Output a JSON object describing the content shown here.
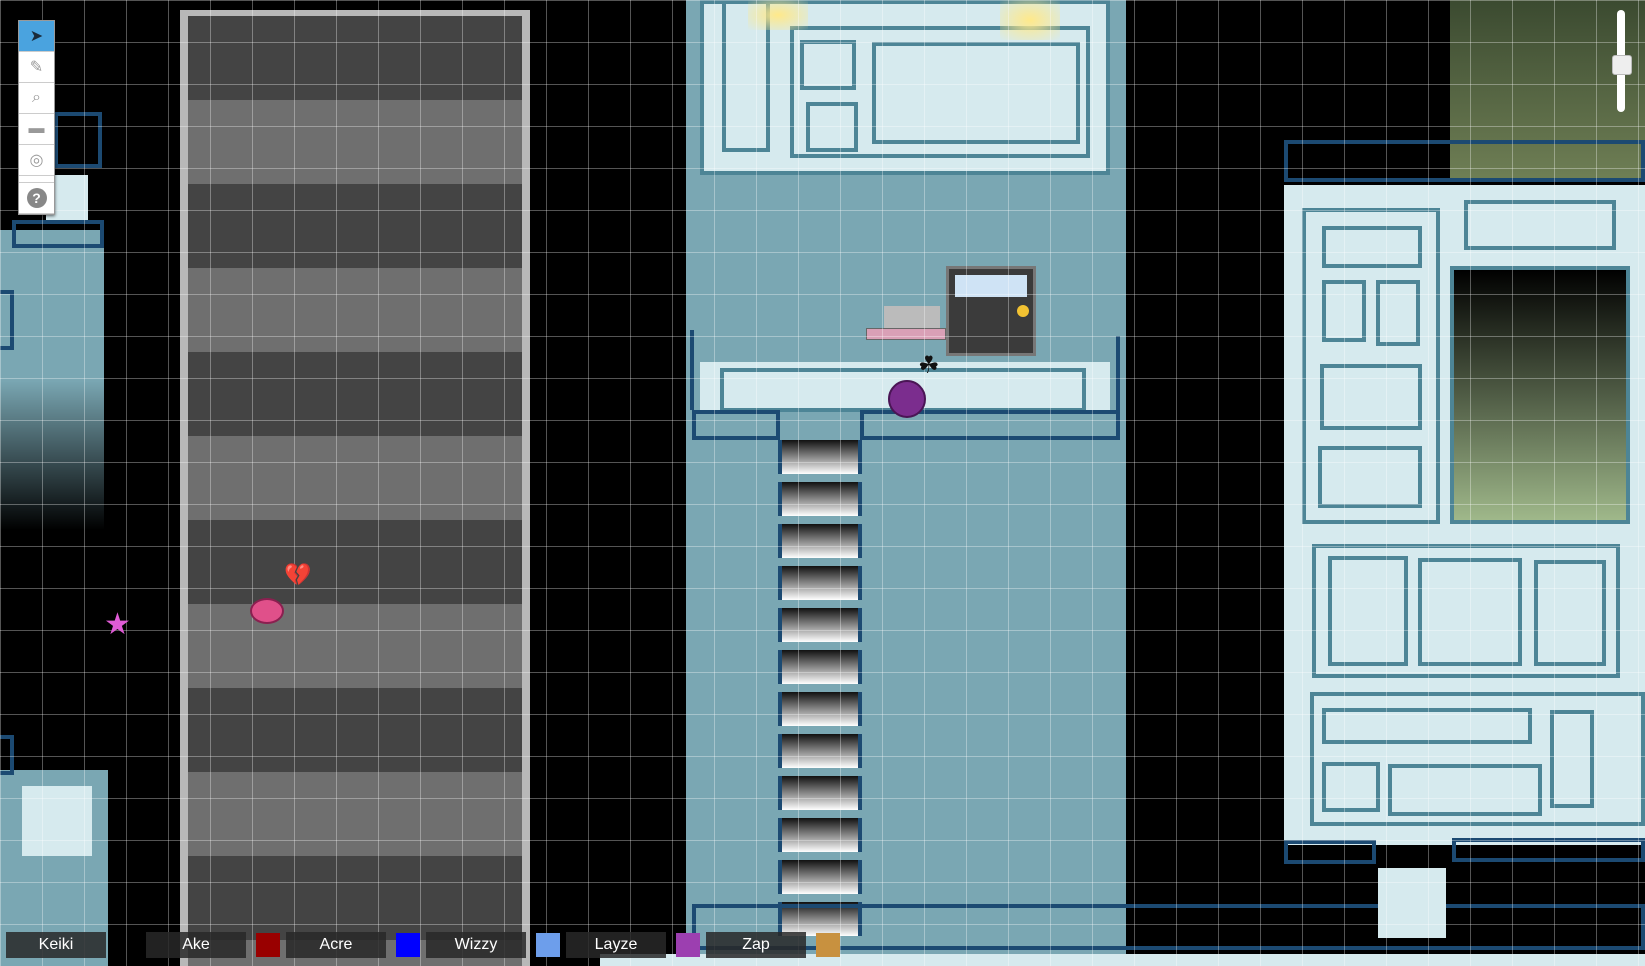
{
  "toolbar": {
    "tools": [
      {
        "name": "select",
        "glyph": "➤"
      },
      {
        "name": "draw",
        "glyph": "✎"
      },
      {
        "name": "zoom",
        "glyph": "⌕"
      },
      {
        "name": "measure",
        "glyph": "▬"
      },
      {
        "name": "target",
        "glyph": "◎"
      }
    ],
    "help_glyph": "?"
  },
  "players": [
    {
      "name": "Keiki",
      "color": ""
    },
    {
      "name": "Ake",
      "color": "#990000"
    },
    {
      "name": "Acre",
      "color": "#0000ff"
    },
    {
      "name": "Wizzy",
      "color": "#6d9eeb"
    },
    {
      "name": "Layze",
      "color": "#9c3fb0"
    },
    {
      "name": "Zap",
      "color": "#c8913f"
    }
  ],
  "tokens": {
    "broken_heart_glyph": "💔",
    "leaf_glyph": "☘"
  },
  "colors": {
    "floor_teal": "#7aa7b3",
    "panel_pale": "#d6eaee",
    "railing_navy": "#1c4a72",
    "token_pink": "#e0508a",
    "token_purple": "#7b2d8e"
  }
}
